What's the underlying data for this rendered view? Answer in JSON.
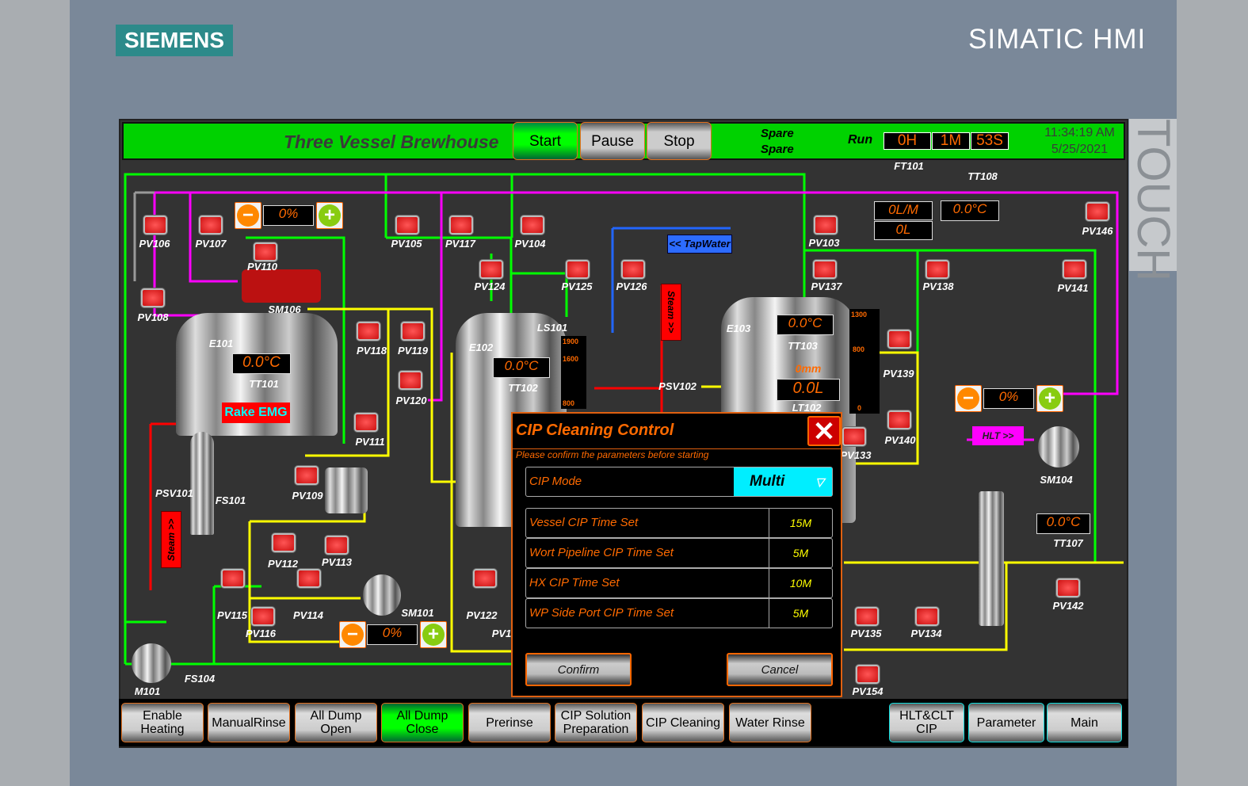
{
  "brand": {
    "logo": "SIEMENS",
    "product": "SIMATIC HMI",
    "bezel_text": "TOUCH"
  },
  "header": {
    "title": "Three Vessel Brewhouse",
    "start": "Start",
    "pause": "Pause",
    "stop": "Stop",
    "spare1": "Spare",
    "spare2": "Spare",
    "run_label": "Run",
    "run_h": "0H",
    "run_m": "1M",
    "run_s": "53S",
    "time": "11:34:19 AM",
    "date": "5/25/2021"
  },
  "valves": [
    "PV106",
    "PV107",
    "PV110",
    "PV108",
    "PV105",
    "PV117",
    "PV104",
    "PV124",
    "PV125",
    "PV126",
    "PV103",
    "PV137",
    "PV138",
    "PV141",
    "PV146",
    "PV118",
    "PV119",
    "PV120",
    "PV111",
    "PV139",
    "PV140",
    "PV133",
    "PV109",
    "PV112",
    "PV113",
    "PV115",
    "PV116",
    "PV114",
    "PV122",
    "PV135",
    "PV134",
    "PV142",
    "PV154"
  ],
  "labels": [
    "SM106",
    "E101",
    "TT101",
    "E102",
    "TT102",
    "LS101",
    "E103",
    "TT103",
    "LT102",
    "PSV102",
    "PSV101",
    "FS101",
    "SM101",
    "M101",
    "FS104",
    "SM104",
    "TT107",
    "FT101",
    "TT108",
    "PV1"
  ],
  "displays": {
    "tt101": "0.0°C",
    "tt102": "0.0°C",
    "tt103": "0.0°C",
    "tt108": "0.0°C",
    "tt107": "0.0°C",
    "ft101_flow": "0L/M",
    "ft101_total": "0L",
    "lt102_volume": "0.0L",
    "lt102_level": "0mm",
    "speed1": "0%",
    "speed2": "0%",
    "speed3": "0%"
  },
  "scales": {
    "tank2": [
      "1900",
      "1600",
      "800"
    ],
    "tank3": [
      "1300",
      "800",
      "0"
    ]
  },
  "process_buttons": {
    "tapwater": "<< TapWater",
    "steam_right": "Steam >>",
    "steam_left": "Steam >>",
    "hlt": "HLT >>",
    "rake_emg": "Rake EMG"
  },
  "dialog": {
    "title": "CIP Cleaning Control",
    "subtitle": "Please confirm the parameters before starting",
    "mode_label": "CIP Mode",
    "mode_value": "Multi",
    "rows": [
      {
        "label": "Vessel CIP Time Set",
        "value": "15M"
      },
      {
        "label": "Wort Pipeline CIP Time Set",
        "value": "5M"
      },
      {
        "label": "HX CIP Time Set",
        "value": "10M"
      },
      {
        "label": "WP Side Port CIP Time Set",
        "value": "5M"
      }
    ],
    "confirm": "Confirm",
    "cancel": "Cancel"
  },
  "footer": [
    "Enable Heating",
    "ManualRinse",
    "All Dump Open",
    "All Dump Close",
    "Prerinse",
    "CIP Solution Preparation",
    "CIP Cleaning",
    "Water Rinse",
    "HLT&CLT CIP",
    "Parameter",
    "Main"
  ],
  "colors": {
    "header": "#00d200",
    "accent": "#ff6a00",
    "water": "#00ff00",
    "hot": "#ff00ff",
    "wort": "#ffff00",
    "steam": "#ff0000",
    "tapwater": "#2266ff",
    "mode": "#00ffff"
  }
}
